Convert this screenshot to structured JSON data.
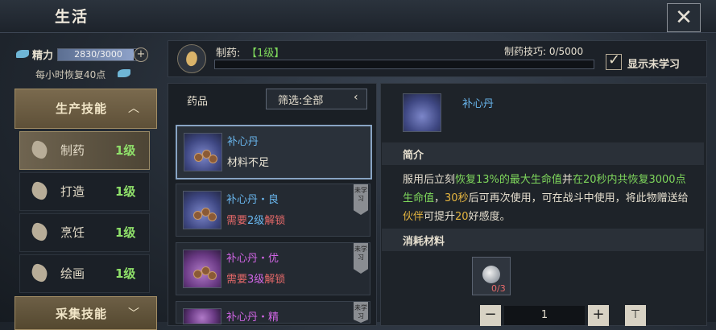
{
  "header": {
    "title": "生活"
  },
  "stamina": {
    "label": "精力",
    "value": "2830/3000",
    "fill": 0.943,
    "regen": "每小时恢复40点"
  },
  "sidebar": {
    "production_label": "生产技能",
    "gathering_label": "采集技能",
    "items": [
      {
        "name": "制药",
        "level": "1级"
      },
      {
        "name": "打造",
        "level": "1级"
      },
      {
        "name": "烹饪",
        "level": "1级"
      },
      {
        "name": "绘画",
        "level": "1级"
      }
    ]
  },
  "craft": {
    "label": "制药:",
    "level": "【1级】",
    "skill_label": "制药技巧: 0/5000",
    "progress": 0,
    "show_unlearned": "显示未学习"
  },
  "list": {
    "title": "药品",
    "filter": "筛选:全部",
    "recipes": [
      {
        "name": "补心丹",
        "sub": "材料不足"
      },
      {
        "name": "补心丹・良",
        "req_a": "需要",
        "req_b": "2级",
        "req_c": "解锁",
        "tag": "未学习"
      },
      {
        "name": "补心丹・优",
        "req_a": "需要",
        "req_b": "3级",
        "req_c": "解锁",
        "tag": "未学习"
      },
      {
        "name": "补心丹・精",
        "tag": "未学习"
      }
    ]
  },
  "detail": {
    "name": "补心丹",
    "intro_label": "简介",
    "desc": {
      "p1": "服用后立刻",
      "p2": "恢复13%的最大生命值",
      "p3": "并",
      "p4": "在20秒内共恢复3000点生命值",
      "p5": "，",
      "p6": "30秒",
      "p7": "后可再次使用，可在战斗中使用，将此物赠送给",
      "p8": "伙伴",
      "p9": "可提升",
      "p10": "20",
      "p11": "好感度。"
    },
    "materials_label": "消耗材料",
    "material_count": "0/3",
    "quantity": "1"
  },
  "colors": {
    "accent_green": "#7fd85c",
    "rare_blue": "#6ab8f0",
    "epic_purple": "#d266e6",
    "warning_red": "#e86a6a"
  }
}
